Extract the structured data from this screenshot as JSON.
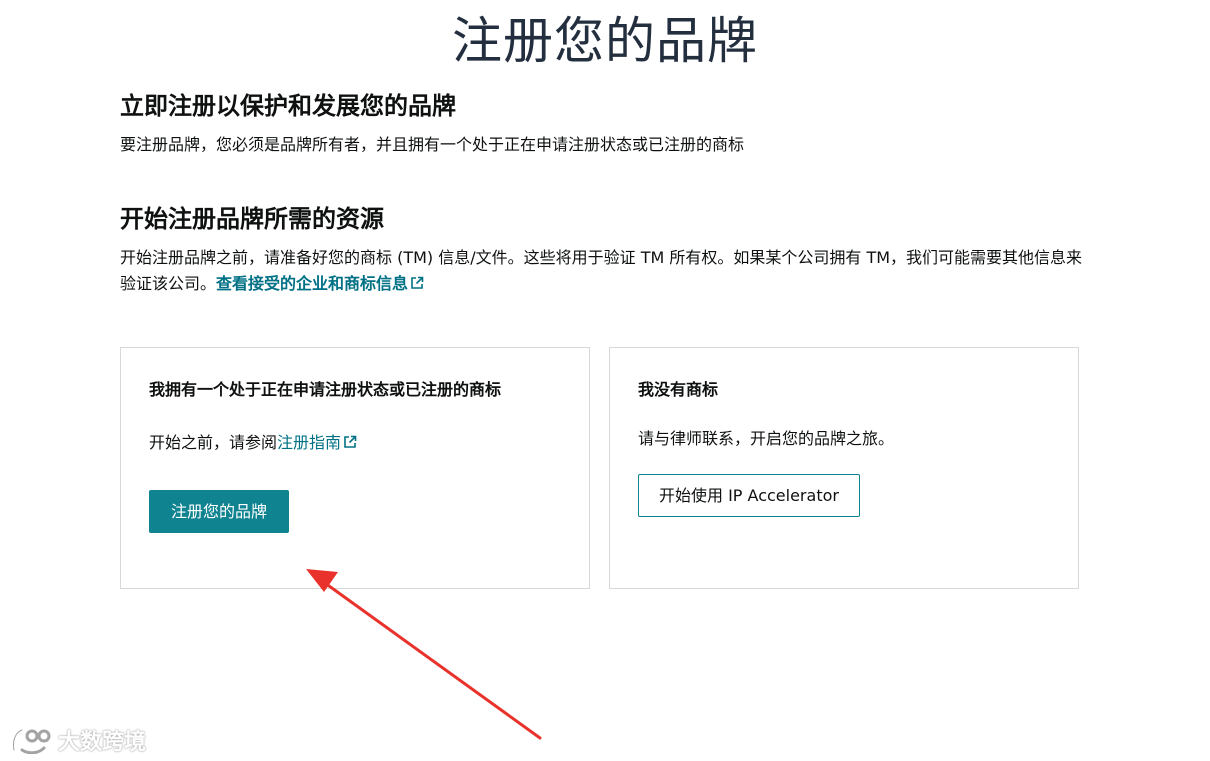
{
  "page": {
    "title": "注册您的品牌"
  },
  "section_protect": {
    "heading": "立即注册以保护和发展您的品牌",
    "text": "要注册品牌，您必须是品牌所有者，并且拥有一个处于正在申请注册状态或已注册的商标"
  },
  "section_resources": {
    "heading": "开始注册品牌所需的资源",
    "text": "开始注册品牌之前，请准备好您的商标 (TM) 信息/文件。这些将用于验证 TM 所有权。如果某个公司拥有 TM，我们可能需要其他信息来验证该公司。",
    "link_label": "查看接受的企业和商标信息"
  },
  "card_has_tm": {
    "title": "我拥有一个处于正在申请注册状态或已注册的商标",
    "text_prefix": "开始之前，请参阅",
    "link_label": "注册指南",
    "button_label": "注册您的品牌"
  },
  "card_no_tm": {
    "title": "我没有商标",
    "text": "请与律师联系，开启您的品牌之旅。",
    "button_label": "开始使用 IP Accelerator"
  },
  "watermark": {
    "text": "大数跨境"
  },
  "colors": {
    "accent": "#108391",
    "link": "#007185",
    "card_border": "#d5d9d9",
    "annotation_arrow": "#e8322b"
  },
  "icons": {
    "external_link": "external-link-icon",
    "annotation": "red-arrow-icon",
    "logo": "watermark-logo-icon"
  }
}
